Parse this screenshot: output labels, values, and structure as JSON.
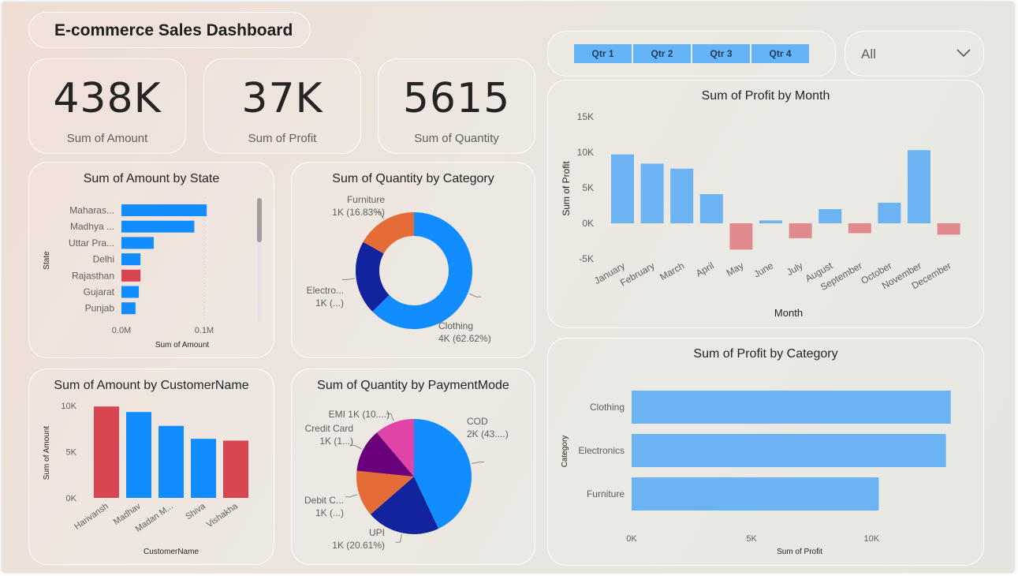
{
  "dashboard": {
    "title": "E-commerce Sales Dashboard"
  },
  "kpis": [
    {
      "value": "438K",
      "label": "Sum of Amount"
    },
    {
      "value": "37K",
      "label": "Sum of Profit"
    },
    {
      "value": "5615",
      "label": "Sum of Quantity"
    }
  ],
  "slicer": {
    "quarters": [
      "Qtr 1",
      "Qtr 2",
      "Qtr 3",
      "Qtr 4"
    ],
    "dropdown_value": "All",
    "button_color": "#65b4f7"
  },
  "icons": {
    "dropdown": "chevron-down-icon"
  },
  "colors": {
    "blue": "#118dff",
    "red": "#d64550",
    "light_blue": "#6bb3f3",
    "light_red": "#e18a8e",
    "navy": "#12239e",
    "orange": "#e66c37",
    "purple": "#6b007b",
    "pink": "#e044a7"
  },
  "chart_data": [
    {
      "id": "amount_by_state",
      "type": "bar",
      "orientation": "horizontal",
      "title": "Sum of Amount by State",
      "xlabel": "Sum of Amount",
      "ylabel": "State",
      "categories": [
        "Maharas...",
        "Madhya ...",
        "Uttar Pra...",
        "Delhi",
        "Rajasthan",
        "Gujarat",
        "Punjab"
      ],
      "values": [
        0.103,
        0.088,
        0.039,
        0.023,
        0.023,
        0.021,
        0.017
      ],
      "highlight": [
        false,
        false,
        false,
        false,
        true,
        false,
        false
      ],
      "xlim": [
        0,
        0.14
      ],
      "xticks": [
        {
          "value": 0,
          "label": "0.0M"
        },
        {
          "value": 0.1,
          "label": "0.1M"
        }
      ]
    },
    {
      "id": "quantity_by_category",
      "type": "pie",
      "donut": true,
      "title": "Sum of Quantity by Category",
      "slices": [
        {
          "name": "Clothing",
          "value": 62.62,
          "label": [
            "Clothing",
            "4K (62.62%)"
          ],
          "color": "#118dff"
        },
        {
          "name": "Electronics",
          "value": 20.55,
          "label": [
            "Electro...",
            "1K (...)"
          ],
          "color": "#12239e"
        },
        {
          "name": "Furniture",
          "value": 16.83,
          "label": [
            "Furniture",
            "1K (16.83%)"
          ],
          "color": "#e66c37"
        }
      ]
    },
    {
      "id": "amount_by_customer",
      "type": "bar",
      "title": "Sum of Amount by CustomerName",
      "xlabel": "CustomerName",
      "ylabel": "Sum of Amount",
      "categories": [
        "Harivansh",
        "Madhav",
        "Madan M...",
        "Shiva",
        "Vishakha"
      ],
      "values": [
        9900,
        9300,
        7800,
        6400,
        6200
      ],
      "highlight": [
        true,
        false,
        false,
        false,
        true
      ],
      "ylim": [
        0,
        10000
      ],
      "yticks": [
        {
          "value": 0,
          "label": "0K"
        },
        {
          "value": 5000,
          "label": "5K"
        },
        {
          "value": 10000,
          "label": "10K"
        }
      ]
    },
    {
      "id": "quantity_by_payment",
      "type": "pie",
      "donut": false,
      "title": "Sum of Quantity by PaymentMode",
      "slices": [
        {
          "name": "COD",
          "value": 43.0,
          "label": [
            "COD",
            "2K (43....)"
          ],
          "color": "#118dff"
        },
        {
          "name": "UPI",
          "value": 20.61,
          "label": [
            "UPI",
            "1K (20.61%)"
          ],
          "color": "#12239e"
        },
        {
          "name": "Debit Card",
          "value": 13.0,
          "label": [
            "Debit C...",
            "1K (...)"
          ],
          "color": "#e66c37"
        },
        {
          "name": "Credit Card",
          "value": 12.2,
          "label": [
            "Credit Card",
            "1K (1...)"
          ],
          "color": "#6b007b"
        },
        {
          "name": "EMI",
          "value": 11.19,
          "label": [
            "EMI 1K (10....)"
          ],
          "color": "#e044a7"
        }
      ]
    },
    {
      "id": "profit_by_month",
      "type": "bar",
      "title": "Sum of Profit by Month",
      "xlabel": "Month",
      "ylabel": "Sum of Profit",
      "categories": [
        "January",
        "February",
        "March",
        "April",
        "May",
        "June",
        "July",
        "August",
        "September",
        "October",
        "November",
        "December"
      ],
      "values": [
        9700,
        8400,
        7700,
        4100,
        -3700,
        400,
        -2100,
        2000,
        -1400,
        2900,
        10300,
        -1600
      ],
      "ylim": [
        -5000,
        15000
      ],
      "yticks": [
        {
          "value": -5000,
          "label": "-5K"
        },
        {
          "value": 0,
          "label": "0K"
        },
        {
          "value": 5000,
          "label": "5K"
        },
        {
          "value": 10000,
          "label": "10K"
        },
        {
          "value": 15000,
          "label": "15K"
        }
      ]
    },
    {
      "id": "profit_by_category",
      "type": "bar",
      "orientation": "horizontal",
      "title": "Sum of Profit by Category",
      "xlabel": "Sum of Profit",
      "ylabel": "Category",
      "categories": [
        "Clothing",
        "Electronics",
        "Furniture"
      ],
      "values": [
        13300,
        13100,
        10300
      ],
      "xlim": [
        0,
        14000
      ],
      "xticks": [
        {
          "value": 0,
          "label": "0K"
        },
        {
          "value": 5000,
          "label": "5K"
        },
        {
          "value": 10000,
          "label": "10K"
        }
      ]
    }
  ]
}
